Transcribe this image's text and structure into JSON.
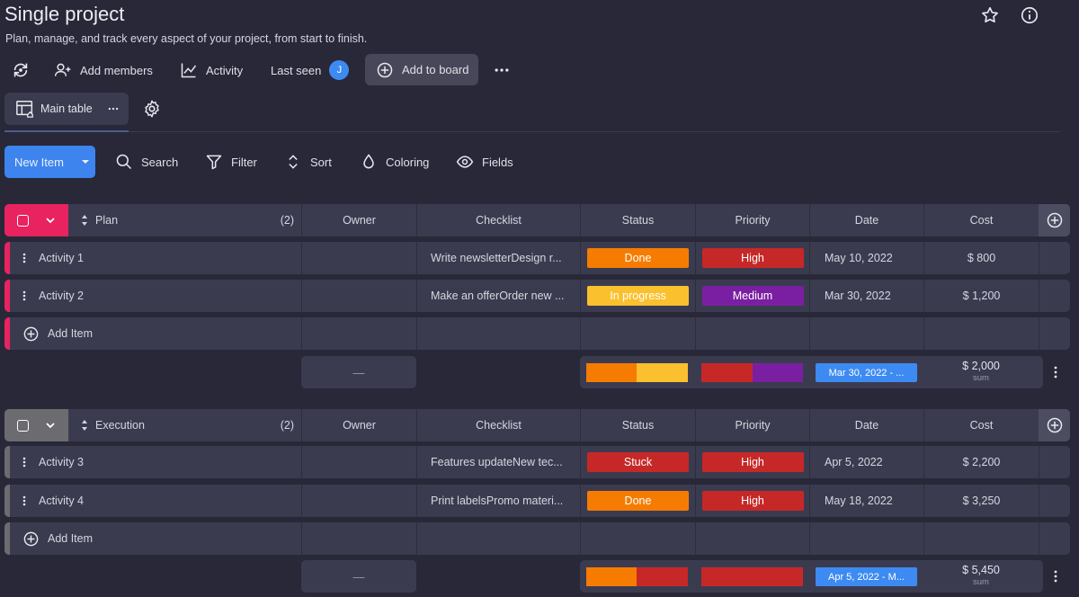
{
  "header": {
    "title": "Single project",
    "subtitle": "Plan, manage, and track every aspect of your project, from start to finish."
  },
  "toolbar": {
    "add_members": "Add members",
    "activity": "Activity",
    "last_seen": "Last seen",
    "avatar_initial": "J",
    "add_to_board": "Add to board"
  },
  "views": {
    "main_table": "Main table"
  },
  "actions": {
    "new_item": "New Item",
    "search": "Search",
    "filter": "Filter",
    "sort": "Sort",
    "coloring": "Coloring",
    "fields": "Fields"
  },
  "columns": [
    "Owner",
    "Checklist",
    "Status",
    "Priority",
    "Date",
    "Cost"
  ],
  "colors": {
    "plan": "#e8235f",
    "execution": "#6c6c70",
    "done": "#f57c00",
    "in_progress": "#fbc02d",
    "stuck": "#c62828",
    "high": "#c62828",
    "medium": "#7b1fa2"
  },
  "groups": [
    {
      "name": "Plan",
      "count": "(2)",
      "add_item": "Add Item",
      "rows": [
        {
          "name": "Activity 1",
          "checklist": "Write newsletterDesign r...",
          "status": "Done",
          "priority": "High",
          "date": "May 10, 2022",
          "cost": "$ 800"
        },
        {
          "name": "Activity 2",
          "checklist": "Make an offerOrder new ...",
          "status": "In progress",
          "priority": "Medium",
          "date": "Mar 30, 2022",
          "cost": "$ 1,200"
        }
      ],
      "summary": {
        "owner": "—",
        "date": "Mar 30, 2022 - ...",
        "cost": "$ 2,000",
        "cost_label": "sum"
      }
    },
    {
      "name": "Execution",
      "count": "(2)",
      "add_item": "Add Item",
      "rows": [
        {
          "name": "Activity 3",
          "checklist": "Features updateNew tec...",
          "status": "Stuck",
          "priority": "High",
          "date": "Apr 5, 2022",
          "cost": "$ 2,200"
        },
        {
          "name": "Activity 4",
          "checklist": "Print labelsPromo materi...",
          "status": "Done",
          "priority": "High",
          "date": "May 18, 2022",
          "cost": "$ 3,250"
        }
      ],
      "summary": {
        "owner": "—",
        "date": "Apr 5, 2022 - M...",
        "cost": "$ 5,450",
        "cost_label": "sum"
      }
    }
  ]
}
